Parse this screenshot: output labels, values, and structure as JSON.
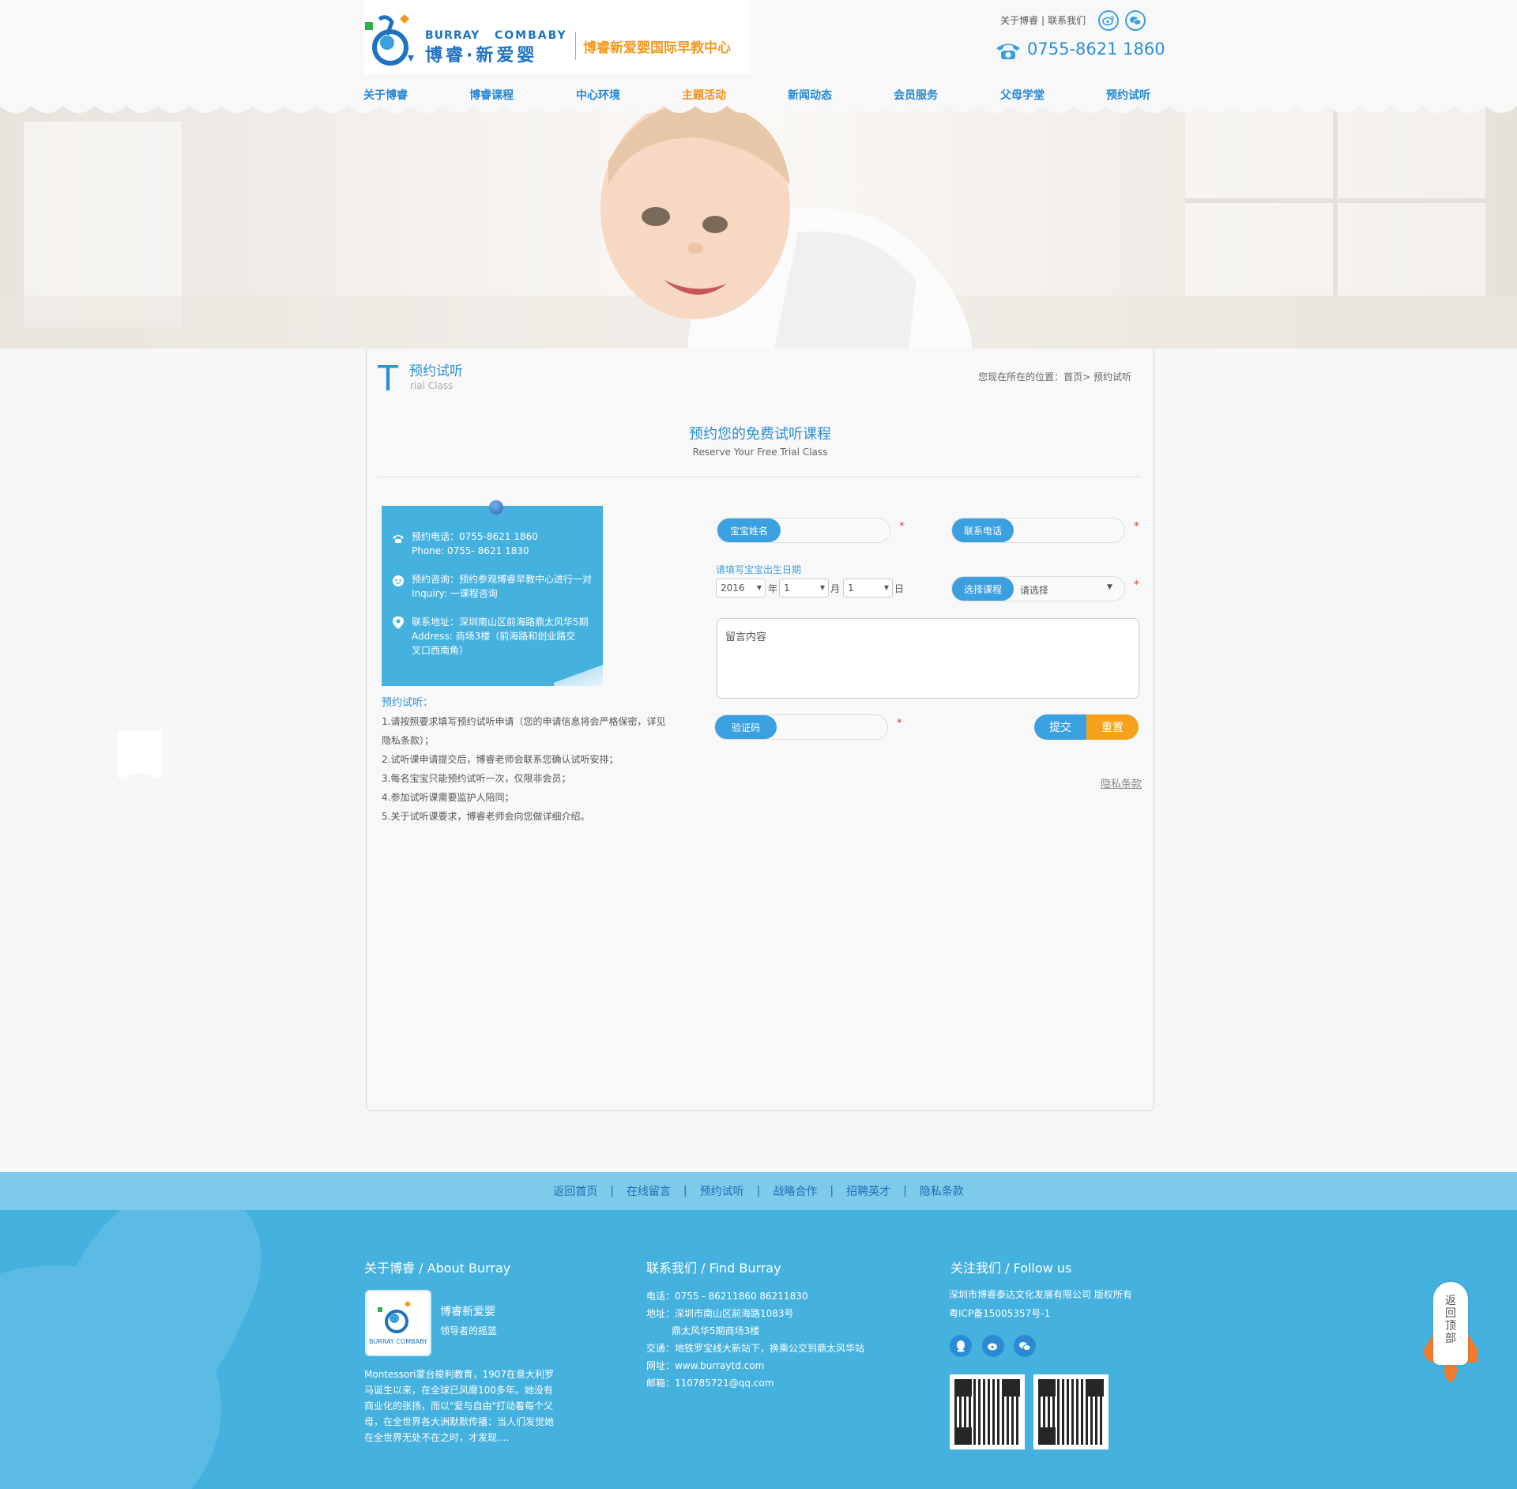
{
  "header": {
    "logo_en_left": "BURRAY",
    "logo_en_right": "COMBABY",
    "logo_cn": "博睿·新爱婴",
    "slogan": "博睿新爱婴国际早教中心",
    "top_links": [
      "关于博睿",
      "联系我们"
    ],
    "top_link_sep": "|",
    "phone": "0755-8621 1860",
    "social_icons": [
      "weibo-icon",
      "wechat-icon"
    ]
  },
  "nav": {
    "items": [
      "关于博睿",
      "博睿课程",
      "中心环境",
      "主题活动",
      "新闻动态",
      "会员服务",
      "父母学堂",
      "预约试听"
    ],
    "active_index": 3
  },
  "page": {
    "T": "T",
    "title": "预约试听",
    "subtitle": "rial Class",
    "breadcrumb": "您现在所在的位置：首页> 预约试听"
  },
  "section": {
    "title": "预约您的免费试听课程",
    "subtitle": "Reserve Your Free Trial Class"
  },
  "info_card": {
    "phone_line1": "预约电话：0755-8621 1860",
    "phone_line2": "Phone:      0755- 8621 1830",
    "inquiry_line1": "预约咨询：预约参观博睿早教中心进行一对",
    "inquiry_line2": "Inquiry:      一课程咨询",
    "address_line1": "联系地址：深圳南山区前海路鼎太风华5期",
    "address_line2": "Address:    商场3楼（前海路和创业路交",
    "address_line3": "叉口西南角）"
  },
  "notes": {
    "title": "预约试听：",
    "items": [
      "1.请按照要求填写预约试听申请（您的申请信息将会严格保密，详见隐私条款）；",
      "2.试听课申请提交后，博睿老师会联系您确认试听安排；",
      "3.每名宝宝只能预约试听一次，仅限非会员；",
      "4.参加试听课需要监护人陪同；",
      "5.关于试听课要求，博睿老师会向您做详细介绍。"
    ]
  },
  "form": {
    "baby_name_label": "宝宝姓名",
    "phone_label": "联系电话",
    "required_mark": "*",
    "birth_hint": "请填写宝宝出生日期",
    "year_value": "2016",
    "year_unit": "年",
    "month_value": "1",
    "month_unit": "月",
    "day_value": "1",
    "day_unit": "日",
    "course_label": "选择课程",
    "course_value": "请选择",
    "message_placeholder": "留言内容",
    "captcha_label": "验证码",
    "submit_label": "提交",
    "reset_label": "重置",
    "privacy_label": "隐私条款"
  },
  "footer": {
    "links": [
      "返回首页",
      "在线留言",
      "预约试听",
      "战略合作",
      "招聘英才",
      "隐私条款"
    ],
    "link_sep": "|",
    "about_heading": "关于博睿 / About Burray",
    "about_name": "博睿新爱婴",
    "about_tagline": "领导者的摇篮",
    "about_text": "Montessori蒙台梭利教育，1907在意大利罗马诞生以来，在全球已风靡100多年。她没有商业化的张扬，而以\"爱与自由\"打动着每个父母，在全世界各大洲默默传播：当人们发觉她在全世界无处不在之时，才发现....",
    "find_heading": "联系我们 / Find Burray",
    "find_lines": [
      "电话：0755 - 86211860  86211830",
      "地址：深圳市南山区前海路1083号",
      "鼎太风华5期商场3楼",
      "交通：地铁罗宝线大新站下，换乘公交到鼎太风华站",
      "网址：www.burraytd.com",
      "邮箱：110785721@qq.com"
    ],
    "follow_heading": "关注我们 / Follow us",
    "company": "深圳市博睿泰达文化发展有限公司 版权所有",
    "icp": "粤ICP备15005357号-1",
    "social_icons": [
      "qq-icon",
      "weibo-icon",
      "wechat-icon"
    ],
    "back_to_top": "返回顶部"
  },
  "colors": {
    "brand_blue": "#2c8fd6",
    "accent_orange": "#f7a11a",
    "footer_blue": "#45b1df",
    "footer_bar": "#7ecaea"
  }
}
